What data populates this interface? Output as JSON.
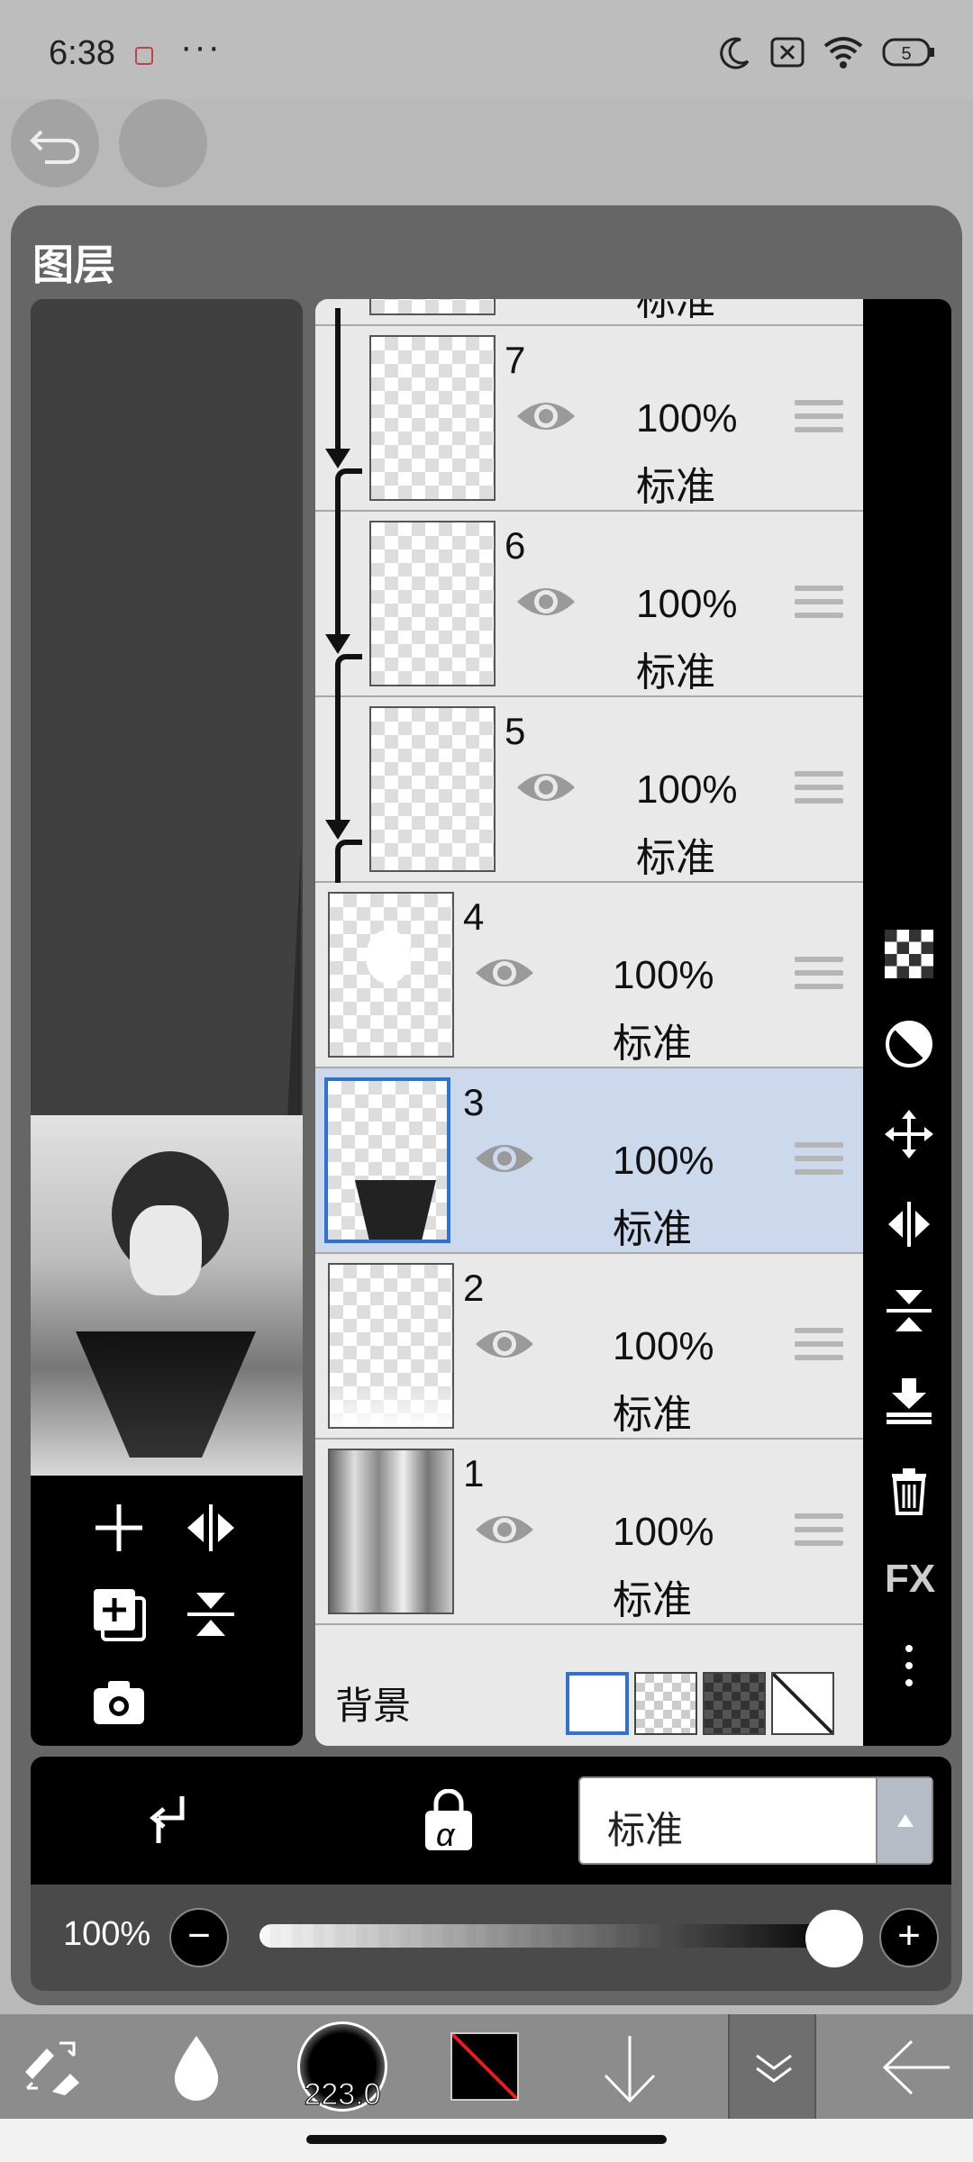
{
  "status_bar": {
    "time": "6:38",
    "more": "···",
    "battery": "5"
  },
  "panel": {
    "title": "图层"
  },
  "layers": [
    {
      "number": "7",
      "opacity": "100%",
      "mode": "标准",
      "clipped": true
    },
    {
      "number": "6",
      "opacity": "100%",
      "mode": "标准",
      "clipped": true
    },
    {
      "number": "5",
      "opacity": "100%",
      "mode": "标准",
      "clipped": true
    },
    {
      "number": "4",
      "opacity": "100%",
      "mode": "标准",
      "clipped": false
    },
    {
      "number": "3",
      "opacity": "100%",
      "mode": "标准",
      "clipped": false,
      "selected": true
    },
    {
      "number": "2",
      "opacity": "100%",
      "mode": "标准",
      "clipped": false
    },
    {
      "number": "1",
      "opacity": "100%",
      "mode": "标准",
      "clipped": false
    }
  ],
  "partial_layer_mode": "标准",
  "background": {
    "label": "背景"
  },
  "side_toolbar": {
    "fx_label": "FX"
  },
  "blend": {
    "mode": "标准",
    "alpha_symbol": "α"
  },
  "opacity": {
    "label": "100%",
    "minus": "−",
    "plus": "+",
    "value": 1.0
  },
  "bottom_toolbar": {
    "brush_size": "223.0"
  },
  "colors": {
    "selected_layer_bg": "#ccd8ec",
    "selected_layer_border": "#2f72d0",
    "panel_bg": "#666666"
  }
}
